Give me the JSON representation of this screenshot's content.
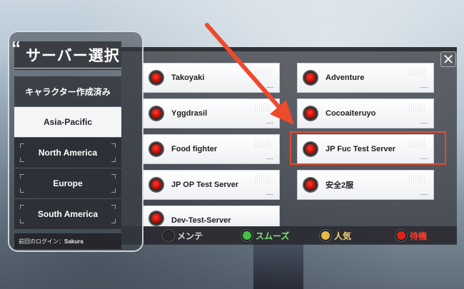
{
  "title": "サーバー選択",
  "title_quote": "“",
  "sidebar": {
    "character_created": "キャラクター作成済み",
    "regions": [
      {
        "label": "Asia-Pacific",
        "active": true
      },
      {
        "label": "North America",
        "active": false
      },
      {
        "label": "Europe",
        "active": false
      },
      {
        "label": "South America",
        "active": false
      }
    ]
  },
  "last_login": {
    "label": "前回のログイン：",
    "value": "Sakura"
  },
  "servers": [
    {
      "name": "Takoyaki",
      "status": "busy"
    },
    {
      "name": "Adventure",
      "status": "busy"
    },
    {
      "name": "Yggdrasil",
      "status": "busy"
    },
    {
      "name": "Cocoaiteruyo",
      "status": "busy"
    },
    {
      "name": "Food fighter",
      "status": "busy"
    },
    {
      "name": "JP Fuc Test Server",
      "status": "busy"
    },
    {
      "name": "JP OP Test Server",
      "status": "busy"
    },
    {
      "name": "安全2服",
      "status": "busy"
    },
    {
      "name": "Dev-Test-Server",
      "status": "busy"
    }
  ],
  "legend": [
    {
      "label": "メンテ",
      "color": "#d9d9d9",
      "dot": "#2b2b2b"
    },
    {
      "label": "スムーズ",
      "color": "#7fe07a",
      "dot": "#43c247"
    },
    {
      "label": "人気",
      "color": "#f1d37a",
      "dot": "#e8b94a"
    },
    {
      "label": "待機",
      "color": "#ff3b2e",
      "dot": "#e0221a"
    }
  ],
  "close_glyph": "✕",
  "colors": {
    "accent": "#e84b2a",
    "status_busy": "#e0221a"
  }
}
